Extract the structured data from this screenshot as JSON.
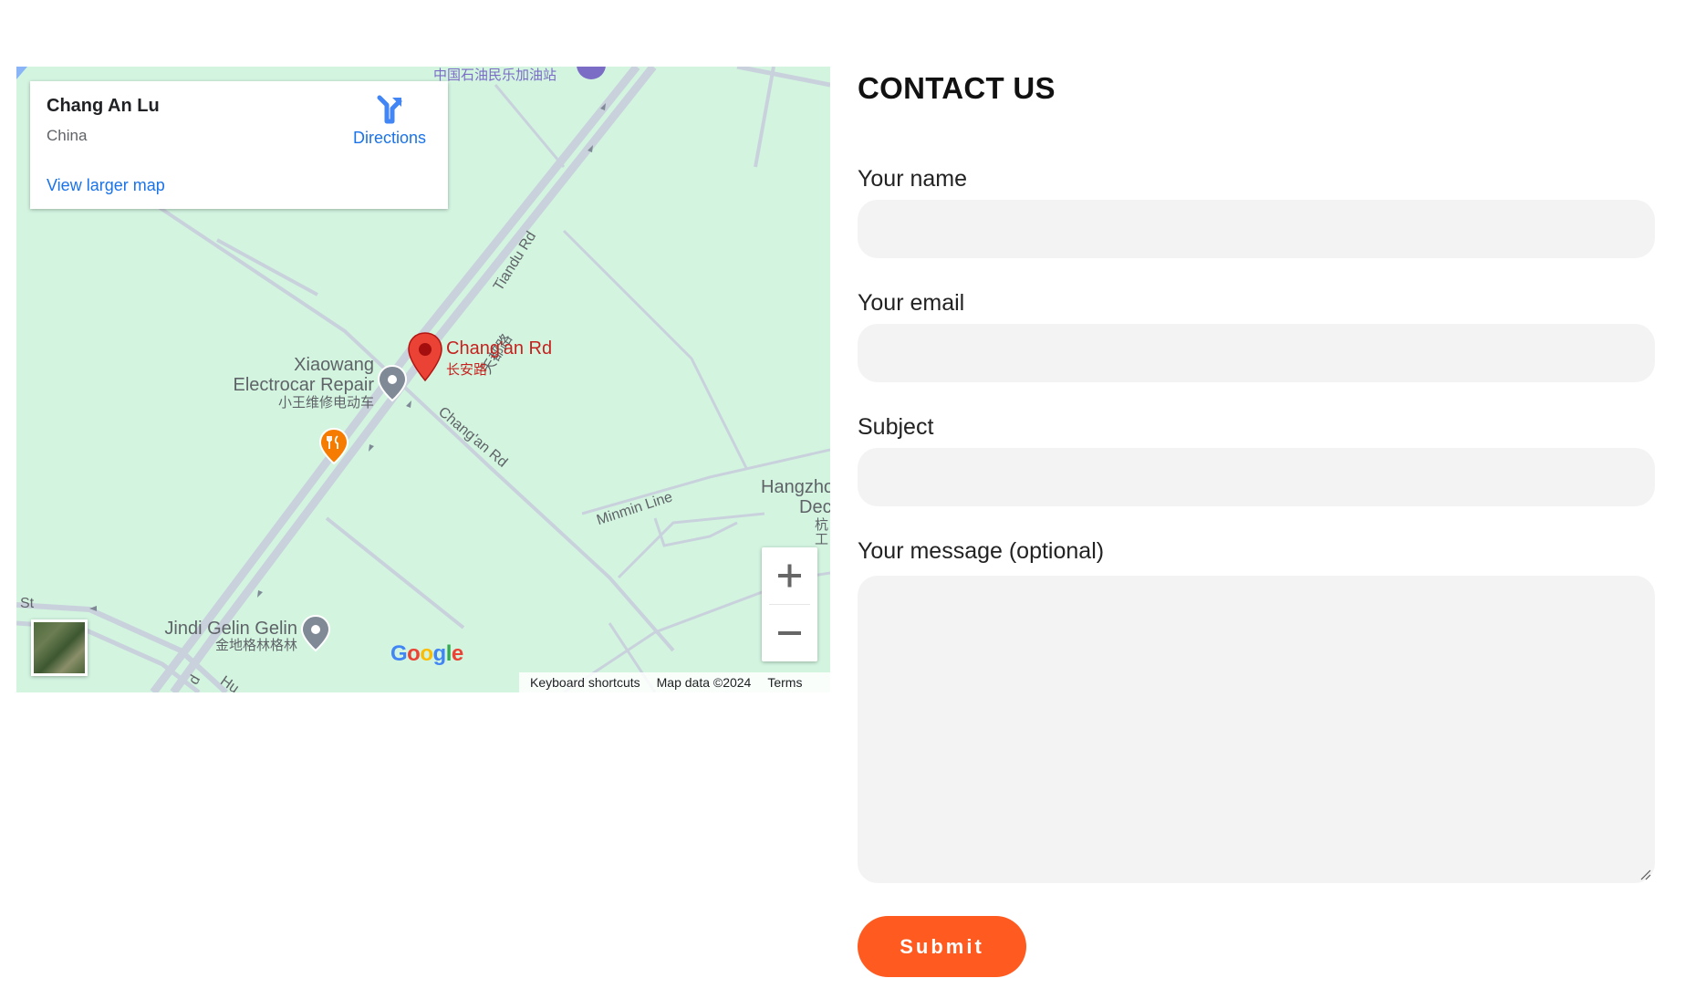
{
  "map": {
    "info_card": {
      "title": "Chang An Lu",
      "subtitle": "China",
      "directions_label": "Directions",
      "larger_map_link": "View larger map"
    },
    "labels": {
      "top_poi": "中国石油民乐加油站",
      "road_tiandu": "Tiandu Rd",
      "road_tiandu_cn": "天都路",
      "pin_title": "Chang'an Rd",
      "pin_sub": "长安路",
      "road_changan": "Chang'an Rd",
      "poi_xiaowang_line1": "Xiaowang",
      "poi_xiaowang_line2": "Electrocar Repair",
      "poi_xiaowang_cn": "小王维修电动车",
      "road_minmin": "Minmin Line",
      "poi_hangzhou_line1": "Hangzho",
      "poi_hangzhou_line2": "Dec",
      "poi_hangzhou_cn1": "杭",
      "poi_hangzhou_cn2": "工",
      "poi_jindi": "Jindi Gelin Gelin",
      "poi_jindi_cn": "金地格林格林",
      "road_st": "St",
      "road_hu": "Hu",
      "road_d": "d"
    },
    "google_logo": "Google",
    "attribution": {
      "shortcuts": "Keyboard shortcuts",
      "map_data": "Map data ©2024",
      "terms": "Terms"
    },
    "colors": {
      "land": "#d3f5e0",
      "road": "#c9d2dc",
      "pin": "#ea4335",
      "link": "#1a73e8"
    },
    "icons": {
      "directions": "directions-icon",
      "zoom_in": "plus-icon",
      "zoom_out": "minus-icon",
      "pin": "map-pin-icon",
      "restaurant": "restaurant-icon"
    }
  },
  "contact": {
    "title": "CONTACT US",
    "fields": {
      "name_label": "Your name",
      "email_label": "Your email",
      "subject_label": "Subject",
      "message_label": "Your message (optional)"
    },
    "submit_label": "Submit",
    "colors": {
      "input_bg": "#f3f3f3",
      "submit_bg": "#ff5a1f"
    }
  }
}
